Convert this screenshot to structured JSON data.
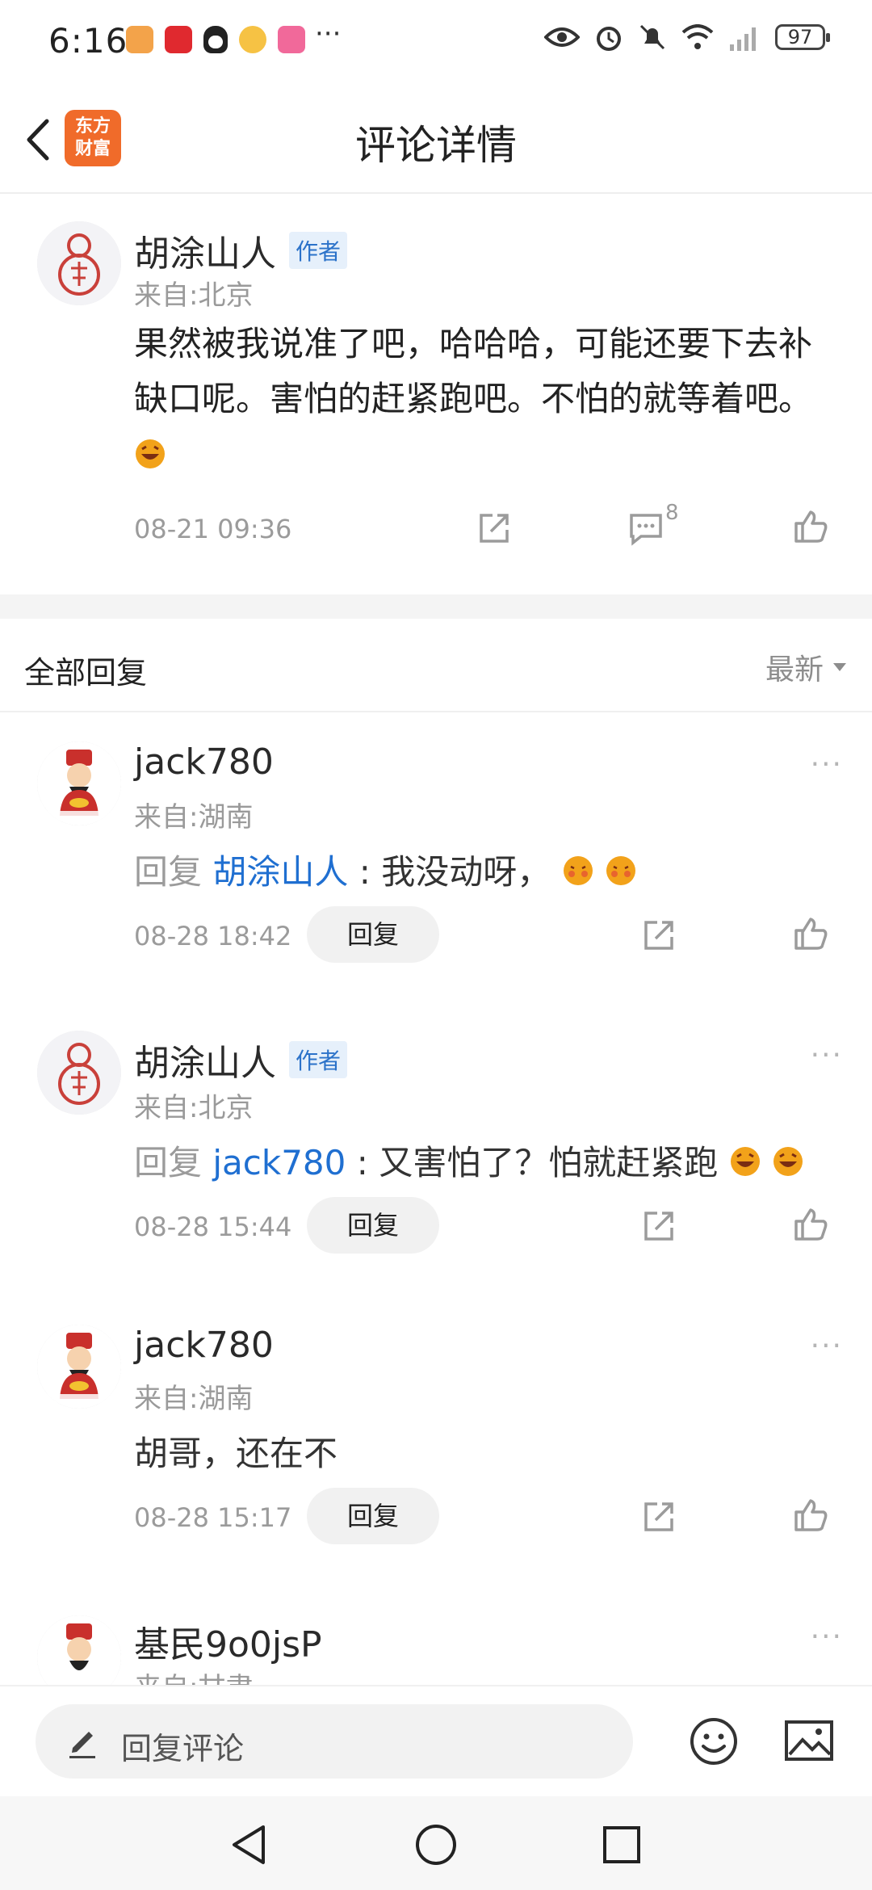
{
  "status": {
    "time": "6:16",
    "battery": "97",
    "more_dots": "···"
  },
  "header": {
    "logo_line1": "东方",
    "logo_line2": "财富",
    "title": "评论详情"
  },
  "main_comment": {
    "author": "胡涂山人",
    "badge": "作者",
    "location": "来自:北京",
    "text": "果然被我说准了吧，哈哈哈，可能还要下去补缺口呢。害怕的赶紧跑吧。不怕的就等着吧。",
    "time": "08-21 09:36",
    "comment_count": "8"
  },
  "replies_section": {
    "title": "全部回复",
    "sort_label": "最新"
  },
  "replies": [
    {
      "author": "jack780",
      "location": "来自:湖南",
      "prefix": "回复",
      "mention": "胡涂山人",
      "text": " : 我没动呀，",
      "time": "08-28 18:42",
      "reply_button": "回复",
      "more": "···"
    },
    {
      "author": "胡涂山人",
      "badge": "作者",
      "location": "来自:北京",
      "prefix": "回复",
      "mention": "jack780",
      "text": " : 又害怕了？怕就赶紧跑",
      "time": "08-28 15:44",
      "reply_button": "回复",
      "more": "···"
    },
    {
      "author": "jack780",
      "location": "来自:湖南",
      "text": "胡哥，还在不",
      "time": "08-28 15:17",
      "reply_button": "回复",
      "more": "···"
    },
    {
      "author": "基民9o0jsP",
      "location": "来自:甘肃",
      "more": "···"
    }
  ],
  "bottom_bar": {
    "input_placeholder": "回复评论"
  },
  "colors": {
    "accent_blue": "#1f6fd1",
    "logo_orange": "#f06b2a"
  }
}
